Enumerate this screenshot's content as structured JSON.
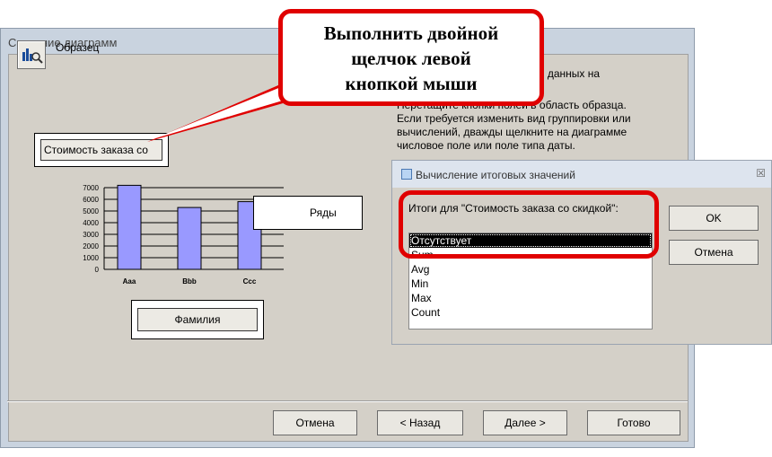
{
  "wizard": {
    "title": "Создание диаграмм",
    "sample_label": "Образец",
    "description": [
      "ения данных на",
      "",
      "Перетащите кнопки полей в область образца.",
      "Если требуется изменить вид группировки или",
      "вычислений, дважды щелкните на диаграмме",
      "числовое поле или поле типа даты."
    ],
    "value_field": "Стоимость заказа со",
    "axis_field": "Фамилия",
    "series_field": "Ряды",
    "buttons": {
      "cancel": "Отмена",
      "back": "< Назад",
      "next": "Далее >",
      "finish": "Готово"
    }
  },
  "dialog": {
    "title": "Вычисление итоговых значений",
    "close_glyph": "☒",
    "label": "Итоги для \"Стоимость заказа со скидкой\":",
    "options": [
      "Отсутствует",
      "Sum",
      "Avg",
      "Min",
      "Max",
      "Count"
    ],
    "selected_index": 0,
    "ok": "OK",
    "cancel": "Отмена"
  },
  "callout": {
    "lines": [
      "Выполнить двойной",
      "щелчок левой",
      "кнопкой мыши"
    ]
  },
  "colors": {
    "highlight": "#e00000",
    "bar_fill": "#9999ff"
  },
  "chart_data": {
    "type": "bar",
    "categories": [
      "Aaa",
      "Bbb",
      "Ccc"
    ],
    "values": [
      7200,
      5300,
      5800
    ],
    "ylim": [
      0,
      7000
    ],
    "y_ticks": [
      "7000",
      "6000",
      "5000",
      "4000",
      "3000",
      "2000",
      "1000",
      "0"
    ],
    "grid": true
  }
}
